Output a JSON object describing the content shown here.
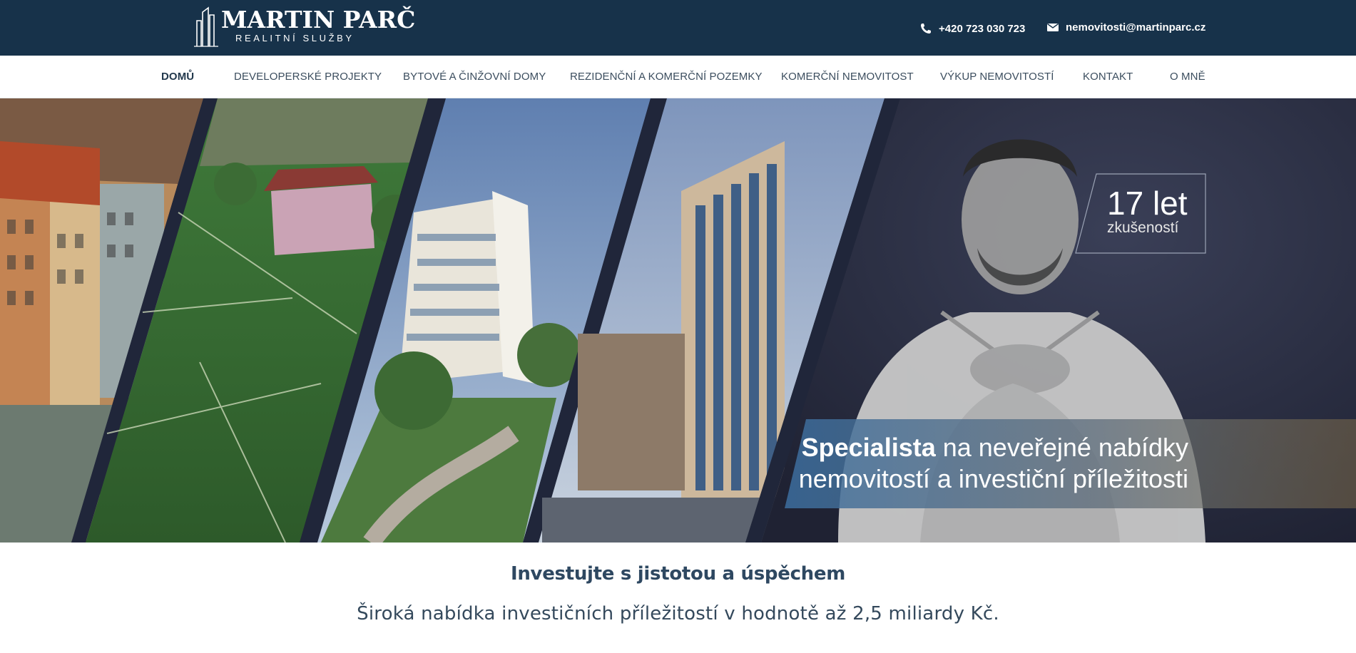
{
  "brand": {
    "name": "MARTIN PARČ",
    "tagline": "REALITNÍ SLUŽBY"
  },
  "contact": {
    "phone": "+420 723 030 723",
    "email": "nemovitosti@martinparc.cz",
    "phone_icon": "phone-icon",
    "email_icon": "envelope-icon"
  },
  "nav": {
    "items": [
      {
        "label": "DOMŮ",
        "active": true
      },
      {
        "label": "DEVELOPERSKÉ PROJEKTY",
        "active": false
      },
      {
        "label": "BYTOVÉ A ČINŽOVNÍ DOMY",
        "active": false
      },
      {
        "label": "REZIDENČNÍ A KOMERČNÍ POZEMKY",
        "active": false
      },
      {
        "label": "KOMERČNÍ NEMOVITOST",
        "active": false
      },
      {
        "label": "VÝKUP NEMOVITOSTÍ",
        "active": false
      },
      {
        "label": "KONTAKT",
        "active": false
      },
      {
        "label": "O MNĚ",
        "active": false
      }
    ]
  },
  "hero": {
    "badge_number": "17 let",
    "badge_text": "zkušeností",
    "slogan_bold": "Specialista",
    "slogan_line1_rest": " na neveřejné nabídky",
    "slogan_line2": "nemovitostí a investiční příležitosti"
  },
  "intro": {
    "headline": "Investujte s jistotou a úspěchem",
    "subline": "Široká nabídka investičních příležitostí v hodnotě až 2,5 miliardy Kč."
  },
  "colors": {
    "topbar": "#17324a",
    "text_dark": "#23394d",
    "hero_dark": "#23283a"
  }
}
